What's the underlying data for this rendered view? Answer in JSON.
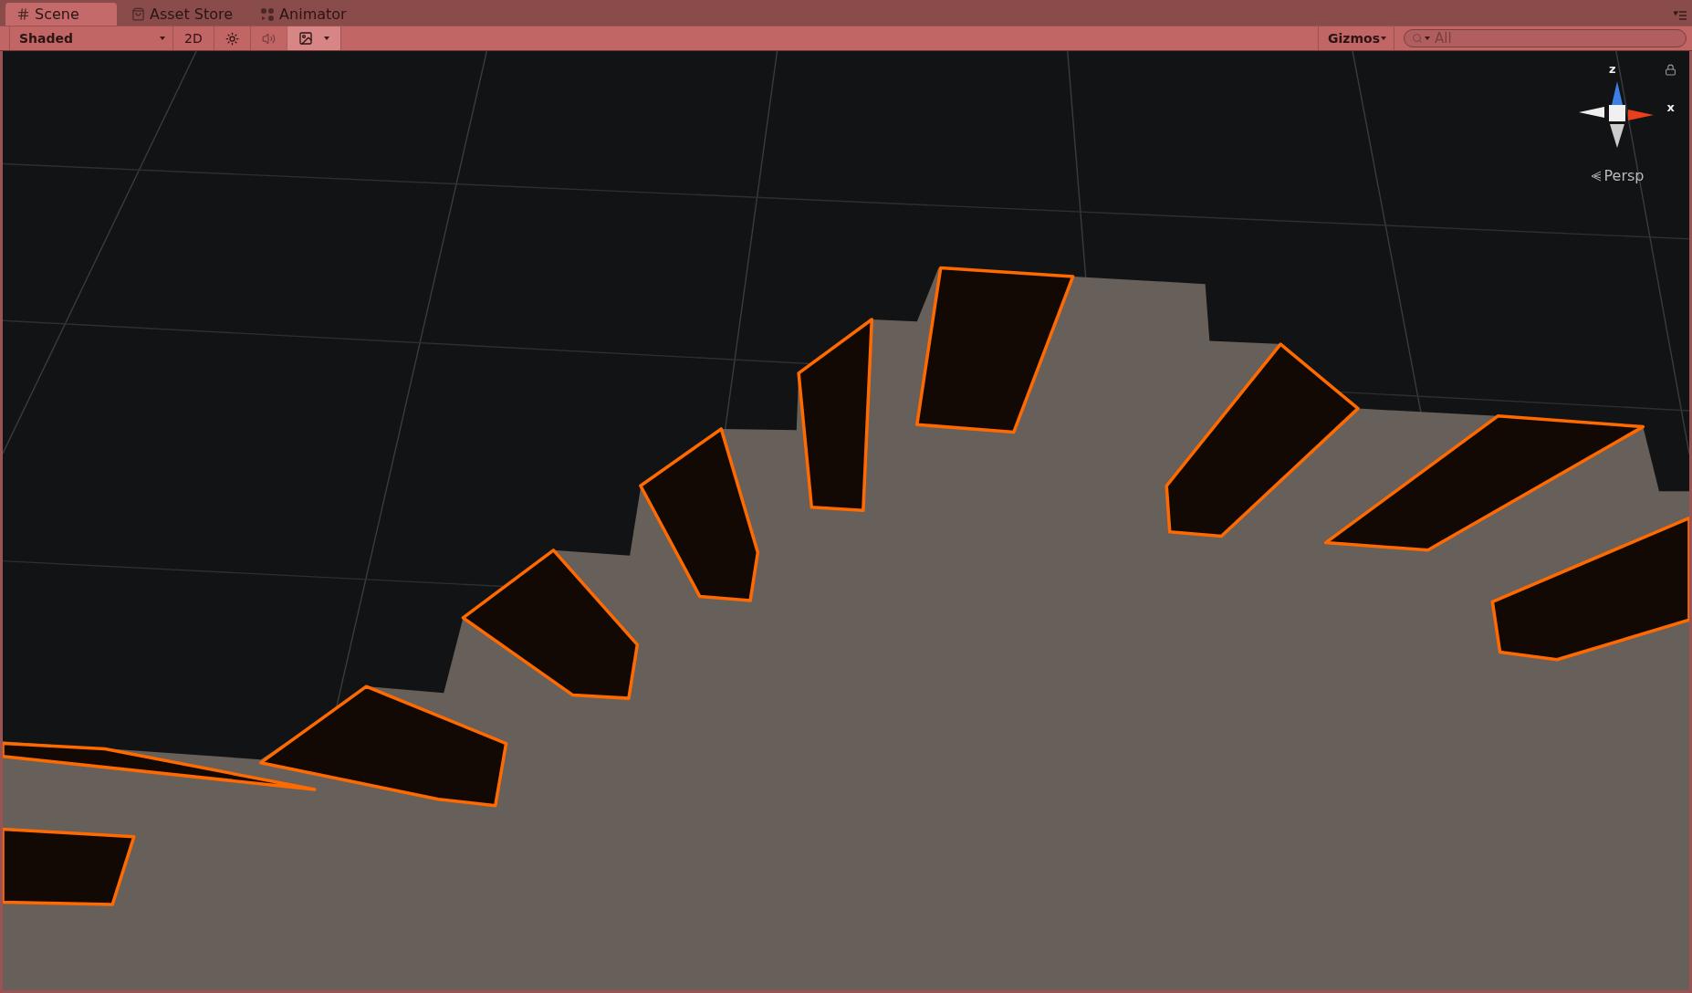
{
  "tabs": [
    {
      "label": "Scene",
      "kind": "scene",
      "selected": true
    },
    {
      "label": "Asset Store",
      "kind": "store",
      "selected": false
    },
    {
      "label": "Animator",
      "kind": "animator",
      "selected": false
    }
  ],
  "toolbar": {
    "draw_mode": "Shaded",
    "mode_2d": {
      "label": "2D",
      "on": false
    },
    "toggles": [
      {
        "kind": "lighting",
        "on": false,
        "disabled": false
      },
      {
        "kind": "audio",
        "on": false,
        "disabled": true
      },
      {
        "kind": "effects",
        "on": true,
        "disabled": false
      }
    ],
    "gizmos": "Gizmos",
    "search": {
      "placeholder": "All"
    }
  },
  "scene_gizmo": {
    "axes": [
      {
        "label": "z",
        "color": "#3d7fe6"
      },
      {
        "label": "x",
        "color": "#e8401c"
      }
    ],
    "projection": "Persp"
  }
}
